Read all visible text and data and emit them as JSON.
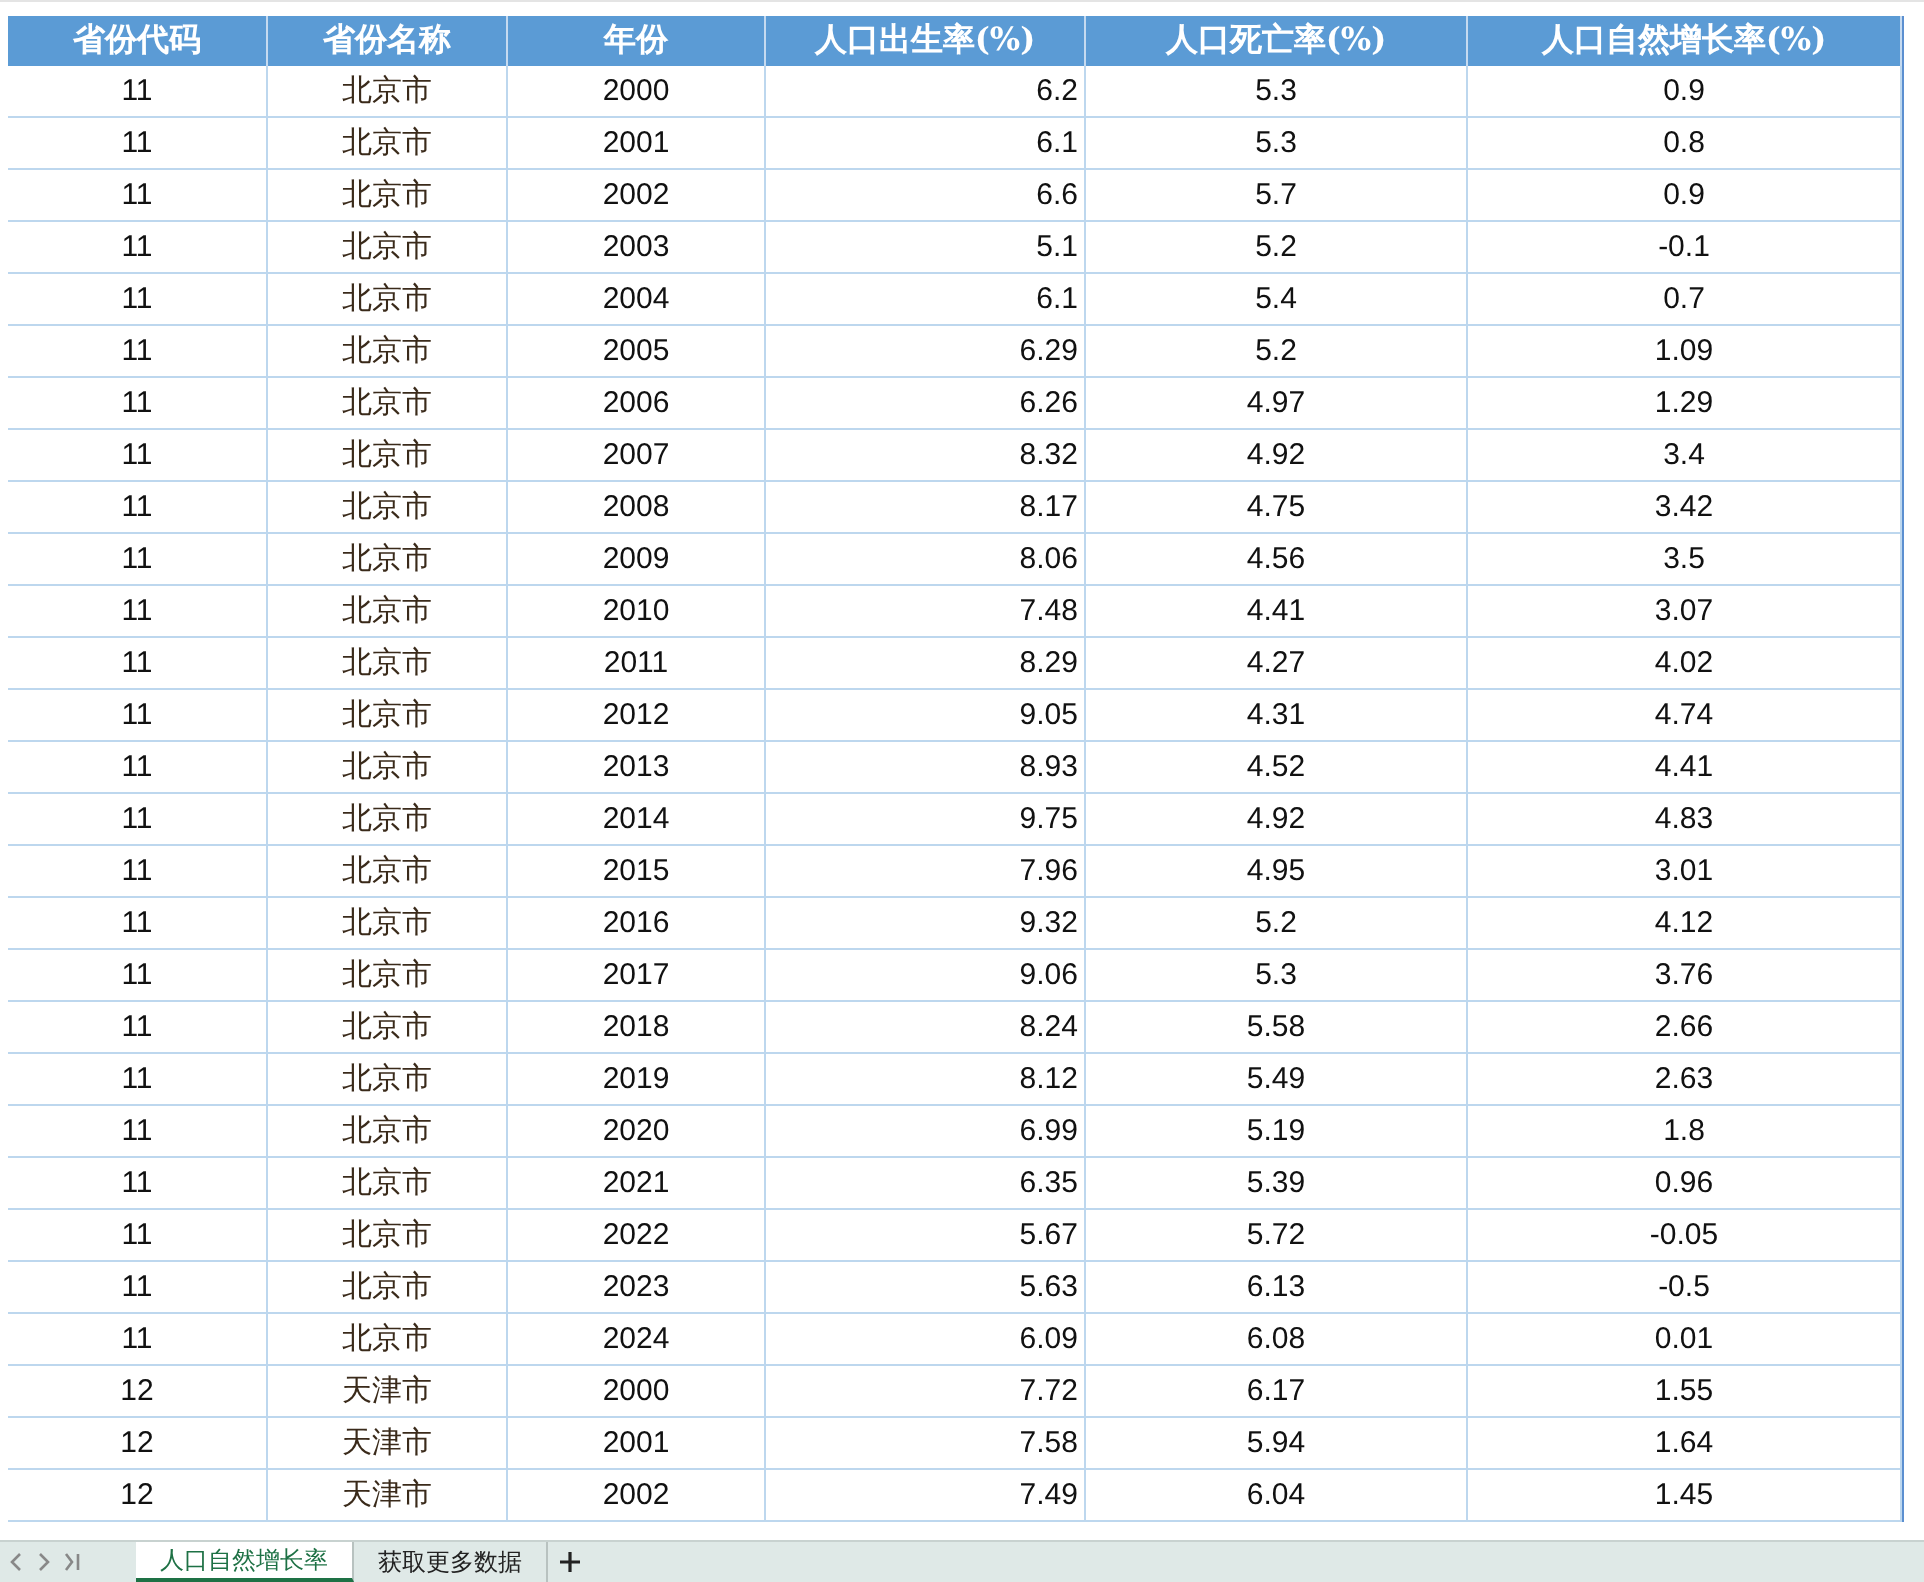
{
  "table": {
    "columns": [
      "省份代码",
      "省份名称",
      "年份",
      "人口出生率(%)",
      "人口死亡率(%)",
      "人口自然增长率(%)"
    ],
    "rows": [
      [
        "11",
        "北京市",
        "2000",
        "6.2",
        "5.3",
        "0.9"
      ],
      [
        "11",
        "北京市",
        "2001",
        "6.1",
        "5.3",
        "0.8"
      ],
      [
        "11",
        "北京市",
        "2002",
        "6.6",
        "5.7",
        "0.9"
      ],
      [
        "11",
        "北京市",
        "2003",
        "5.1",
        "5.2",
        "-0.1"
      ],
      [
        "11",
        "北京市",
        "2004",
        "6.1",
        "5.4",
        "0.7"
      ],
      [
        "11",
        "北京市",
        "2005",
        "6.29",
        "5.2",
        "1.09"
      ],
      [
        "11",
        "北京市",
        "2006",
        "6.26",
        "4.97",
        "1.29"
      ],
      [
        "11",
        "北京市",
        "2007",
        "8.32",
        "4.92",
        "3.4"
      ],
      [
        "11",
        "北京市",
        "2008",
        "8.17",
        "4.75",
        "3.42"
      ],
      [
        "11",
        "北京市",
        "2009",
        "8.06",
        "4.56",
        "3.5"
      ],
      [
        "11",
        "北京市",
        "2010",
        "7.48",
        "4.41",
        "3.07"
      ],
      [
        "11",
        "北京市",
        "2011",
        "8.29",
        "4.27",
        "4.02"
      ],
      [
        "11",
        "北京市",
        "2012",
        "9.05",
        "4.31",
        "4.74"
      ],
      [
        "11",
        "北京市",
        "2013",
        "8.93",
        "4.52",
        "4.41"
      ],
      [
        "11",
        "北京市",
        "2014",
        "9.75",
        "4.92",
        "4.83"
      ],
      [
        "11",
        "北京市",
        "2015",
        "7.96",
        "4.95",
        "3.01"
      ],
      [
        "11",
        "北京市",
        "2016",
        "9.32",
        "5.2",
        "4.12"
      ],
      [
        "11",
        "北京市",
        "2017",
        "9.06",
        "5.3",
        "3.76"
      ],
      [
        "11",
        "北京市",
        "2018",
        "8.24",
        "5.58",
        "2.66"
      ],
      [
        "11",
        "北京市",
        "2019",
        "8.12",
        "5.49",
        "2.63"
      ],
      [
        "11",
        "北京市",
        "2020",
        "6.99",
        "5.19",
        "1.8"
      ],
      [
        "11",
        "北京市",
        "2021",
        "6.35",
        "5.39",
        "0.96"
      ],
      [
        "11",
        "北京市",
        "2022",
        "5.67",
        "5.72",
        "-0.05"
      ],
      [
        "11",
        "北京市",
        "2023",
        "5.63",
        "6.13",
        "-0.5"
      ],
      [
        "11",
        "北京市",
        "2024",
        "6.09",
        "6.08",
        "0.01"
      ],
      [
        "12",
        "天津市",
        "2000",
        "7.72",
        "6.17",
        "1.55"
      ],
      [
        "12",
        "天津市",
        "2001",
        "7.58",
        "5.94",
        "1.64"
      ],
      [
        "12",
        "天津市",
        "2002",
        "7.49",
        "6.04",
        "1.45"
      ]
    ]
  },
  "sheet_tabs": [
    {
      "label": "人口自然增长率",
      "selected": true
    },
    {
      "label": "获取更多数据",
      "selected": false
    }
  ]
}
